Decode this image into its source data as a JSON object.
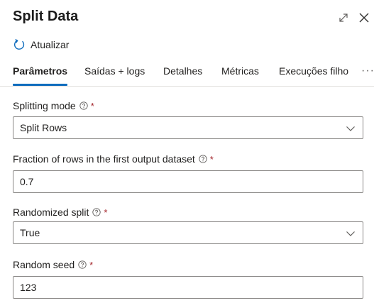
{
  "panel": {
    "title": "Split Data",
    "refresh_label": "Atualizar"
  },
  "tabs": [
    {
      "label": "Parâmetros",
      "active": true
    },
    {
      "label": "Saídas + logs"
    },
    {
      "label": "Detalhes"
    },
    {
      "label": "Métricas"
    },
    {
      "label": "Execuções filho"
    },
    {
      "label": "···"
    }
  ],
  "fields": {
    "splitting_mode": {
      "label": "Splitting mode",
      "required_mark": "*",
      "value": "Split Rows"
    },
    "fraction": {
      "label": "Fraction of rows in the first output dataset",
      "required_mark": "*",
      "value": "0.7"
    },
    "randomized_split": {
      "label": "Randomized split",
      "required_mark": "*",
      "value": "True"
    },
    "random_seed": {
      "label": "Random seed",
      "required_mark": "*",
      "value": "123"
    }
  },
  "icons": {
    "expand": "expand-icon",
    "close": "close-icon",
    "refresh": "refresh-icon",
    "help": "help-circle-icon",
    "chevron": "chevron-down-icon"
  },
  "colors": {
    "accent": "#0f6cbd",
    "required": "#a4262c",
    "border": "#8a8886"
  }
}
